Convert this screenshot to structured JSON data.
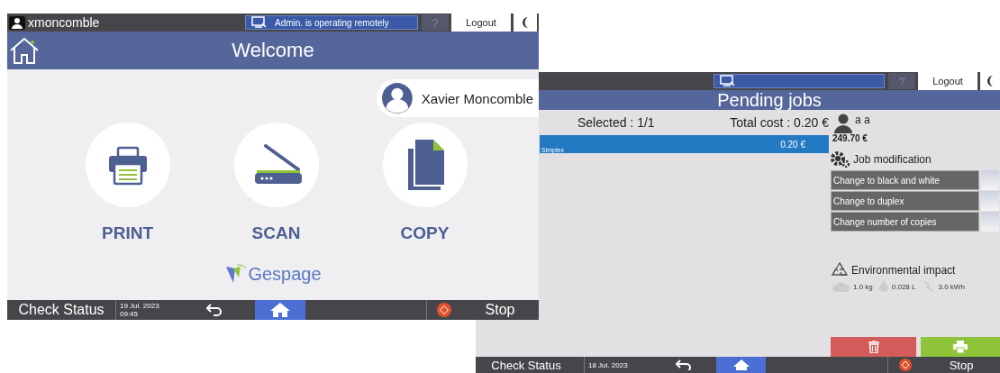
{
  "welcome_screen": {
    "top_bar": {
      "username": "xmoncomble",
      "remote_status": "Admin. is operating remotely",
      "help": "?",
      "logout": "Logout"
    },
    "title": "Welcome",
    "user_name": "Xavier Moncomble",
    "actions": [
      {
        "kind": "print",
        "label": "PRINT"
      },
      {
        "kind": "scan",
        "label": "SCAN"
      },
      {
        "kind": "copy",
        "label": "COPY"
      }
    ],
    "logo": "Gespage",
    "bottom_bar": {
      "check_status": "Check Status",
      "date": "19 Jul. 2023",
      "time": "09:45",
      "stop": "Stop"
    }
  },
  "pending_jobs_screen": {
    "top_bar": {
      "help": "?",
      "logout": "Logout"
    },
    "title": "Pending jobs",
    "selected_count": "Selected : 1/1",
    "total_cost": "Total cost : 0.20 €",
    "jobs": [
      {
        "description": "Simplex",
        "cost": "0.20 €",
        "selected": true
      }
    ],
    "account": {
      "name": "a a",
      "balance": "249.70 €"
    },
    "job_modification": {
      "title": "Job modification",
      "options": [
        "Change to black and white",
        "Change to duplex",
        "Change number of copies"
      ]
    },
    "environmental_impact": {
      "title": "Environmental impact",
      "metrics": [
        {
          "kind": "co2",
          "value": "1.0 kg"
        },
        {
          "kind": "water",
          "value": "0.028 L"
        },
        {
          "kind": "energy",
          "value": "3.0 kWh"
        }
      ]
    },
    "bottom_bar": {
      "check_status": "Check Status",
      "date": "18 Jul. 2023",
      "stop": "Stop"
    }
  }
}
